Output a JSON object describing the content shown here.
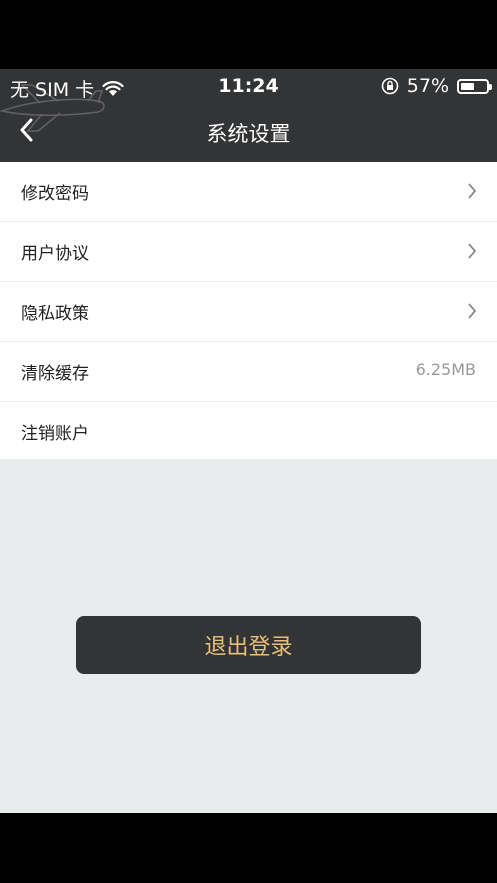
{
  "status_bar": {
    "carrier": "无 SIM 卡",
    "time": "11:24",
    "battery": "57%",
    "battery_level": 0.57
  },
  "header": {
    "title": "系统设置"
  },
  "settings": [
    {
      "label": "修改密码",
      "value": "",
      "chevron": true
    },
    {
      "label": "用户协议",
      "value": "",
      "chevron": true
    },
    {
      "label": "隐私政策",
      "value": "",
      "chevron": true
    },
    {
      "label": "清除缓存",
      "value": "6.25MB",
      "chevron": false
    },
    {
      "label": "注销账户",
      "value": "",
      "chevron": false
    }
  ],
  "logout": {
    "label": "退出登录"
  },
  "colors": {
    "header_bg": "#333436",
    "button_text": "#e7c179",
    "page_bg": "#e9ecec"
  },
  "icons": {
    "back": "chevron-left-icon",
    "row": "chevron-right-icon",
    "wifi": "wifi-icon",
    "lock": "orientation-lock-icon",
    "battery": "battery-icon"
  }
}
